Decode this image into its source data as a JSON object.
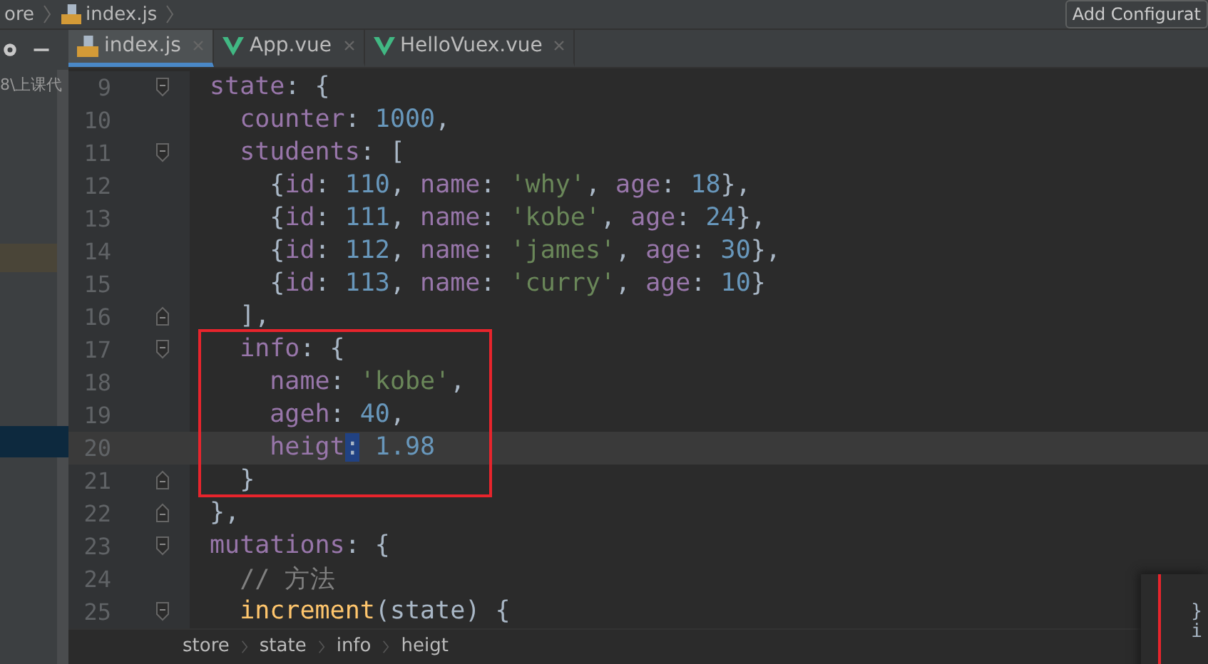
{
  "nav_bar": {
    "crumbs": [
      "ore",
      "index.js"
    ],
    "run_config": "Add Configurat"
  },
  "tabs": [
    {
      "label": "index.js",
      "kind": "js",
      "selected": true
    },
    {
      "label": "App.vue",
      "kind": "vue",
      "selected": false
    },
    {
      "label": "HelloVuex.vue",
      "kind": "vue",
      "selected": false
    }
  ],
  "project_panel": {
    "path": "8\\上课代"
  },
  "editor": {
    "lines": [
      {
        "number": "9",
        "kind": "fold_start",
        "current": false,
        "tokens": [
          {
            "text": "state",
            "kind": "key"
          },
          {
            "text": ": {",
            "kind": "punct"
          }
        ]
      },
      {
        "number": "10",
        "kind": "code",
        "current": false,
        "tokens": [
          {
            "text": "  counter",
            "kind": "key"
          },
          {
            "text": ": ",
            "kind": "punct"
          },
          {
            "text": "1000",
            "kind": "number"
          },
          {
            "text": ",",
            "kind": "punct"
          }
        ]
      },
      {
        "number": "11",
        "kind": "fold_start",
        "current": false,
        "tokens": [
          {
            "text": "  students",
            "kind": "key"
          },
          {
            "text": ": [",
            "kind": "punct"
          }
        ]
      },
      {
        "number": "12",
        "kind": "code",
        "current": false,
        "tokens": [
          {
            "text": "    {",
            "kind": "punct"
          },
          {
            "text": "id",
            "kind": "key"
          },
          {
            "text": ": ",
            "kind": "punct"
          },
          {
            "text": "110",
            "kind": "number"
          },
          {
            "text": ", ",
            "kind": "punct"
          },
          {
            "text": "name",
            "kind": "key"
          },
          {
            "text": ": ",
            "kind": "punct"
          },
          {
            "text": "'why'",
            "kind": "string"
          },
          {
            "text": ", ",
            "kind": "punct"
          },
          {
            "text": "age",
            "kind": "key"
          },
          {
            "text": ": ",
            "kind": "punct"
          },
          {
            "text": "18",
            "kind": "number"
          },
          {
            "text": "},",
            "kind": "punct"
          }
        ]
      },
      {
        "number": "13",
        "kind": "code",
        "current": false,
        "tokens": [
          {
            "text": "    {",
            "kind": "punct"
          },
          {
            "text": "id",
            "kind": "key"
          },
          {
            "text": ": ",
            "kind": "punct"
          },
          {
            "text": "111",
            "kind": "number"
          },
          {
            "text": ", ",
            "kind": "punct"
          },
          {
            "text": "name",
            "kind": "key"
          },
          {
            "text": ": ",
            "kind": "punct"
          },
          {
            "text": "'kobe'",
            "kind": "string"
          },
          {
            "text": ", ",
            "kind": "punct"
          },
          {
            "text": "age",
            "kind": "key"
          },
          {
            "text": ": ",
            "kind": "punct"
          },
          {
            "text": "24",
            "kind": "number"
          },
          {
            "text": "},",
            "kind": "punct"
          }
        ]
      },
      {
        "number": "14",
        "kind": "code",
        "current": false,
        "tokens": [
          {
            "text": "    {",
            "kind": "punct"
          },
          {
            "text": "id",
            "kind": "key"
          },
          {
            "text": ": ",
            "kind": "punct"
          },
          {
            "text": "112",
            "kind": "number"
          },
          {
            "text": ", ",
            "kind": "punct"
          },
          {
            "text": "name",
            "kind": "key"
          },
          {
            "text": ": ",
            "kind": "punct"
          },
          {
            "text": "'james'",
            "kind": "string"
          },
          {
            "text": ", ",
            "kind": "punct"
          },
          {
            "text": "age",
            "kind": "key"
          },
          {
            "text": ": ",
            "kind": "punct"
          },
          {
            "text": "30",
            "kind": "number"
          },
          {
            "text": "},",
            "kind": "punct"
          }
        ]
      },
      {
        "number": "15",
        "kind": "code",
        "current": false,
        "tokens": [
          {
            "text": "    {",
            "kind": "punct"
          },
          {
            "text": "id",
            "kind": "key"
          },
          {
            "text": ": ",
            "kind": "punct"
          },
          {
            "text": "113",
            "kind": "number"
          },
          {
            "text": ", ",
            "kind": "punct"
          },
          {
            "text": "name",
            "kind": "key"
          },
          {
            "text": ": ",
            "kind": "punct"
          },
          {
            "text": "'curry'",
            "kind": "string"
          },
          {
            "text": ", ",
            "kind": "punct"
          },
          {
            "text": "age",
            "kind": "key"
          },
          {
            "text": ": ",
            "kind": "punct"
          },
          {
            "text": "10",
            "kind": "number"
          },
          {
            "text": "}",
            "kind": "punct"
          }
        ]
      },
      {
        "number": "16",
        "kind": "fold_end",
        "current": false,
        "tokens": [
          {
            "text": "  ],",
            "kind": "punct"
          }
        ]
      },
      {
        "number": "17",
        "kind": "fold_start",
        "current": false,
        "tokens": [
          {
            "text": "  info",
            "kind": "key"
          },
          {
            "text": ": {",
            "kind": "punct"
          }
        ]
      },
      {
        "number": "18",
        "kind": "code",
        "current": false,
        "tokens": [
          {
            "text": "    name",
            "kind": "key"
          },
          {
            "text": ": ",
            "kind": "punct"
          },
          {
            "text": "'kobe'",
            "kind": "string"
          },
          {
            "text": ",",
            "kind": "punct"
          }
        ]
      },
      {
        "number": "19",
        "kind": "code",
        "current": false,
        "tokens": [
          {
            "text": "    ageh",
            "kind": "key"
          },
          {
            "text": ": ",
            "kind": "punct"
          },
          {
            "text": "40",
            "kind": "number"
          },
          {
            "text": ",",
            "kind": "punct"
          }
        ]
      },
      {
        "number": "20",
        "kind": "code",
        "current": true,
        "tokens": [
          {
            "text": "    heigt",
            "kind": "key"
          },
          {
            "text": ":",
            "kind": "selected"
          },
          {
            "text": " 1.98",
            "kind": "number"
          }
        ]
      },
      {
        "number": "21",
        "kind": "fold_end",
        "current": false,
        "tokens": [
          {
            "text": "  }",
            "kind": "punct"
          }
        ]
      },
      {
        "number": "22",
        "kind": "fold_end",
        "current": false,
        "tokens": [
          {
            "text": "},",
            "kind": "punct"
          }
        ]
      },
      {
        "number": "23",
        "kind": "fold_start",
        "current": false,
        "tokens": [
          {
            "text": "mutations",
            "kind": "key"
          },
          {
            "text": ": {",
            "kind": "punct"
          }
        ]
      },
      {
        "number": "24",
        "kind": "code",
        "current": false,
        "tokens": [
          {
            "text": "  // 方法",
            "kind": "comment"
          }
        ]
      },
      {
        "number": "25",
        "kind": "fold_start",
        "current": false,
        "tokens": [
          {
            "text": "  increment",
            "kind": "function"
          },
          {
            "text": "(state) {",
            "kind": "punct"
          }
        ]
      }
    ]
  },
  "breadcrumbs": [
    "store",
    "state",
    "info",
    "heigt"
  ],
  "preview": {
    "lines": [
      "}",
      "i"
    ]
  }
}
